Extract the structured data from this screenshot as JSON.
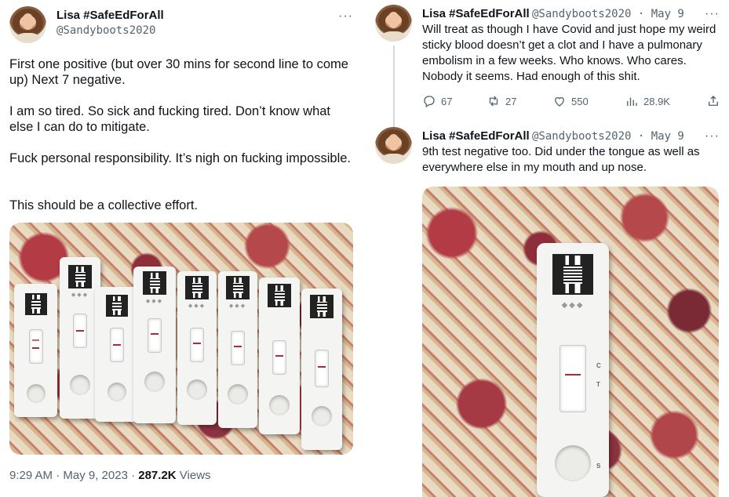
{
  "left_tweet": {
    "author_name": "Lisa #SafeEdForAll",
    "handle": "@Sandyboots2020",
    "more": "···",
    "paragraphs": [
      "First one positive (but over 30 mins for second line to come up) Next 7 negative.",
      "I am so tired. So sick and fucking tired. Don’t know what else I can do to mitigate.",
      "Fuck personal responsibility. It’s nigh on fucking impossible.",
      "This should be a collective effort."
    ],
    "timestamp": "9:29 AM · May 9, 2023 · ",
    "views_count": "287.2K",
    "views_label": " Views"
  },
  "right_tweets": [
    {
      "author_name": "Lisa #SafeEdForAll",
      "handle_date": "@Sandyboots2020 · May 9",
      "more": "···",
      "text": "Will treat as though I have Covid and just hope my weird sticky blood doesn’t get a clot and I have a pulmonary embolism in a few weeks. Who knows. Who cares. Nobody it seems. Had enough of this shit.",
      "actions": {
        "replies": "67",
        "retweets": "27",
        "likes": "550",
        "views": "28.9K"
      }
    },
    {
      "author_name": "Lisa #SafeEdForAll",
      "handle_date": "@Sandyboots2020 · May 9",
      "more": "···",
      "text": "9th test negative too. Did under the tongue as well as everywhere else in my mouth and up nose."
    }
  ],
  "icons": [
    "reply-icon",
    "retweet-icon",
    "like-icon",
    "views-icon",
    "share-icon",
    "more-icon",
    "avatar"
  ],
  "colors": {
    "text": "#0f1419",
    "secondary": "#536471",
    "thread_line": "#cfd9de",
    "test_line": "#b3263b"
  }
}
